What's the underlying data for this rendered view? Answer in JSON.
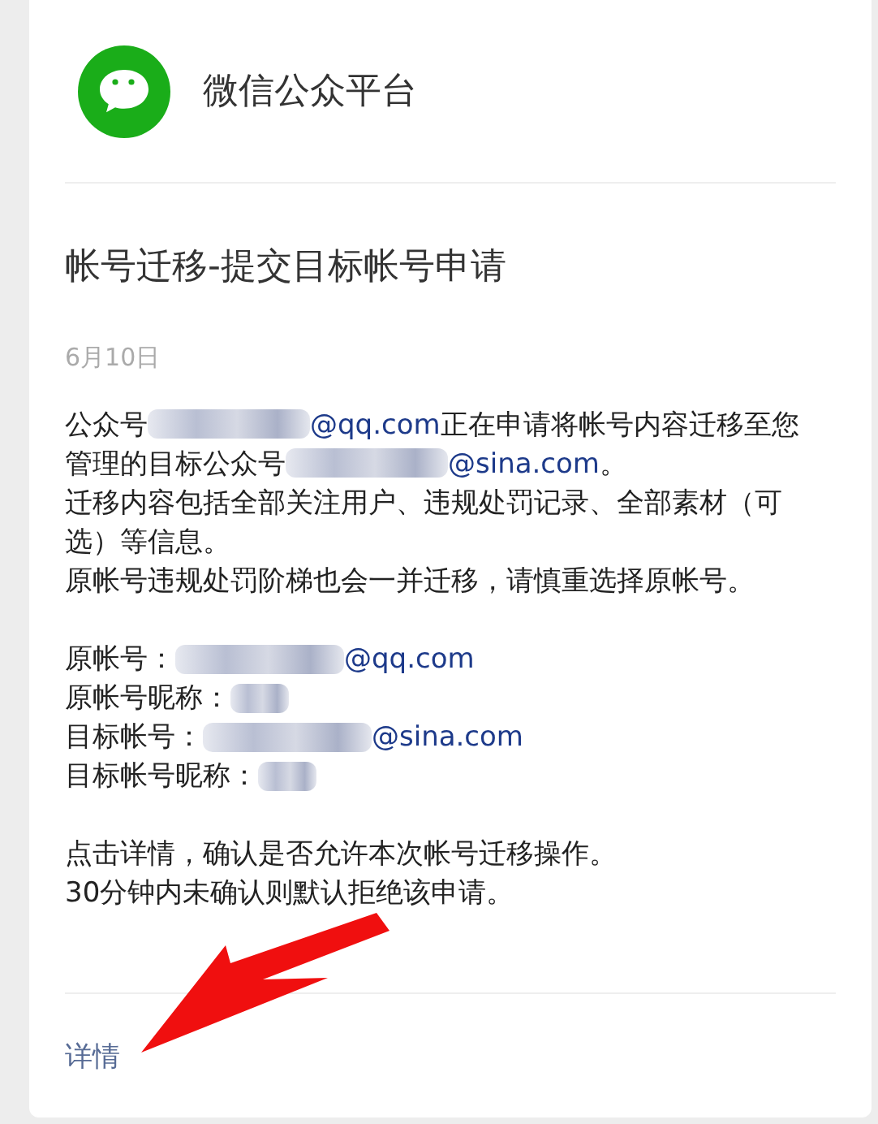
{
  "header": {
    "account_name": "微信公众平台"
  },
  "message": {
    "title": "帐号迁移-提交目标帐号申请",
    "date": "6月10日",
    "paragraphs": [
      {
        "segments": [
          {
            "kind": "text",
            "text": "公众号"
          },
          {
            "kind": "redacted"
          },
          {
            "kind": "email",
            "text": "@qq.com"
          },
          {
            "kind": "text",
            "text": "正在申请将帐号内容迁移至您管理的目标公众号"
          },
          {
            "kind": "redacted"
          },
          {
            "kind": "email",
            "text": "@sina.com"
          },
          {
            "kind": "text",
            "text": "。"
          }
        ]
      },
      {
        "segments": [
          {
            "kind": "text",
            "text": "迁移内容包括全部关注用户、违规处罚记录、全部素材（可选）等信息。"
          }
        ]
      },
      {
        "segments": [
          {
            "kind": "text",
            "text": "原帐号违规处罚阶梯也会一并迁移，请慎重选择原帐号。"
          }
        ]
      }
    ],
    "fields": [
      {
        "label": "原帐号：",
        "value": "@qq.com"
      },
      {
        "label": "原帐号昵称："
      },
      {
        "label": "目标帐号：",
        "value": "@sina.com"
      },
      {
        "label": "目标帐号昵称："
      }
    ],
    "notes": [
      "点击详情，确认是否允许本次帐号迁移操作。",
      "30分钟内未确认则默认拒绝该申请。"
    ],
    "details_link": "详情"
  }
}
